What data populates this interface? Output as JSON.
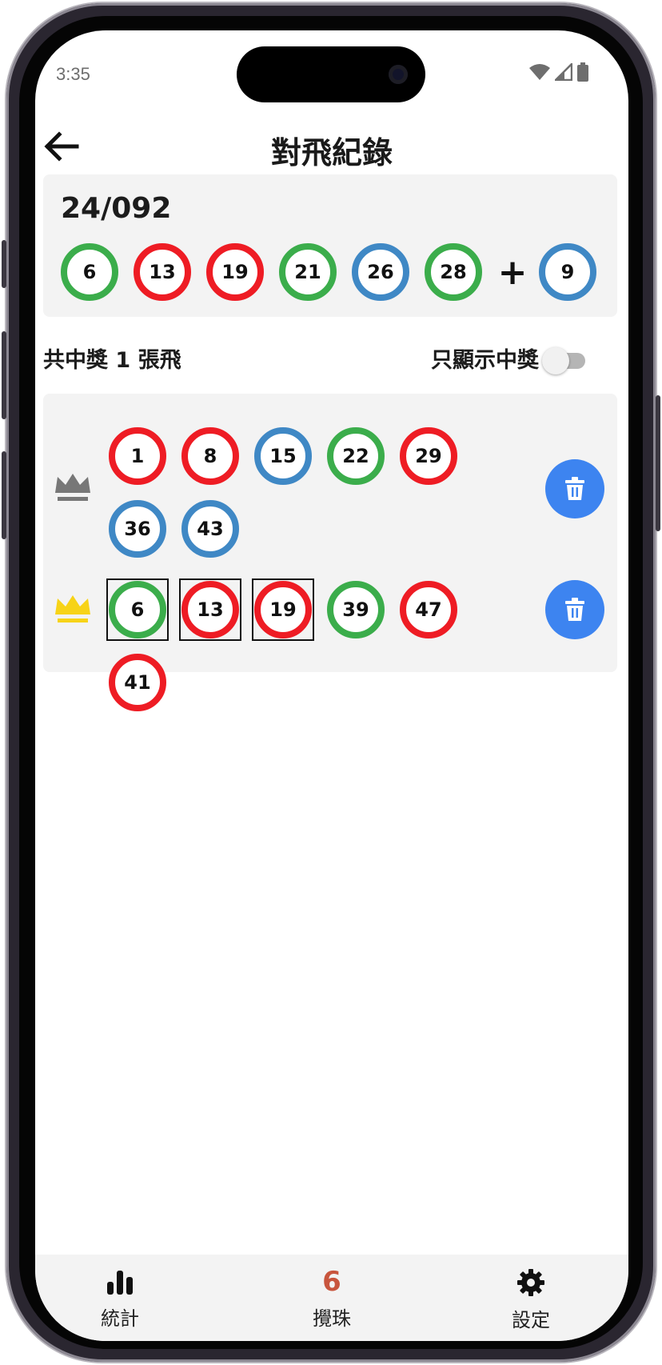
{
  "status_bar": {
    "time": "3:35"
  },
  "header": {
    "title": "對飛紀錄"
  },
  "result": {
    "draw_id": "24/092",
    "numbers": [
      {
        "n": "6",
        "color": "green"
      },
      {
        "n": "13",
        "color": "red"
      },
      {
        "n": "19",
        "color": "red"
      },
      {
        "n": "21",
        "color": "green"
      },
      {
        "n": "26",
        "color": "blue"
      },
      {
        "n": "28",
        "color": "green"
      }
    ],
    "plus": "+",
    "special": {
      "n": "9",
      "color": "blue"
    }
  },
  "summary": {
    "text": "共中獎 1 張飛"
  },
  "filter": {
    "label": "只顯示中獎",
    "on": false
  },
  "tickets": [
    {
      "winning": false,
      "numbers": [
        {
          "n": "1",
          "color": "red",
          "hit": false
        },
        {
          "n": "8",
          "color": "red",
          "hit": false
        },
        {
          "n": "15",
          "color": "blue",
          "hit": false
        },
        {
          "n": "22",
          "color": "green",
          "hit": false
        },
        {
          "n": "29",
          "color": "red",
          "hit": false
        },
        {
          "n": "36",
          "color": "blue",
          "hit": false
        },
        {
          "n": "43",
          "color": "blue",
          "hit": false
        }
      ]
    },
    {
      "winning": true,
      "numbers": [
        {
          "n": "6",
          "color": "green",
          "hit": true
        },
        {
          "n": "13",
          "color": "red",
          "hit": true
        },
        {
          "n": "19",
          "color": "red",
          "hit": true
        },
        {
          "n": "39",
          "color": "green",
          "hit": false
        },
        {
          "n": "47",
          "color": "red",
          "hit": false
        },
        {
          "n": "41",
          "color": "red",
          "hit": false
        }
      ]
    }
  ],
  "bottom_nav": [
    {
      "label": "統計",
      "icon": "bar-chart-icon",
      "active": false
    },
    {
      "label": "攪珠",
      "icon": "six-icon",
      "active": true,
      "glyph": "6"
    },
    {
      "label": "設定",
      "icon": "gear-icon",
      "active": false
    }
  ],
  "colors": {
    "red": "#ee1c24",
    "green": "#3bad4b",
    "blue": "#3f88c5",
    "delete": "#3d84f0",
    "crown_gold": "#f7d317",
    "crown_gray": "#777777",
    "nav_active": "#c8553d"
  }
}
